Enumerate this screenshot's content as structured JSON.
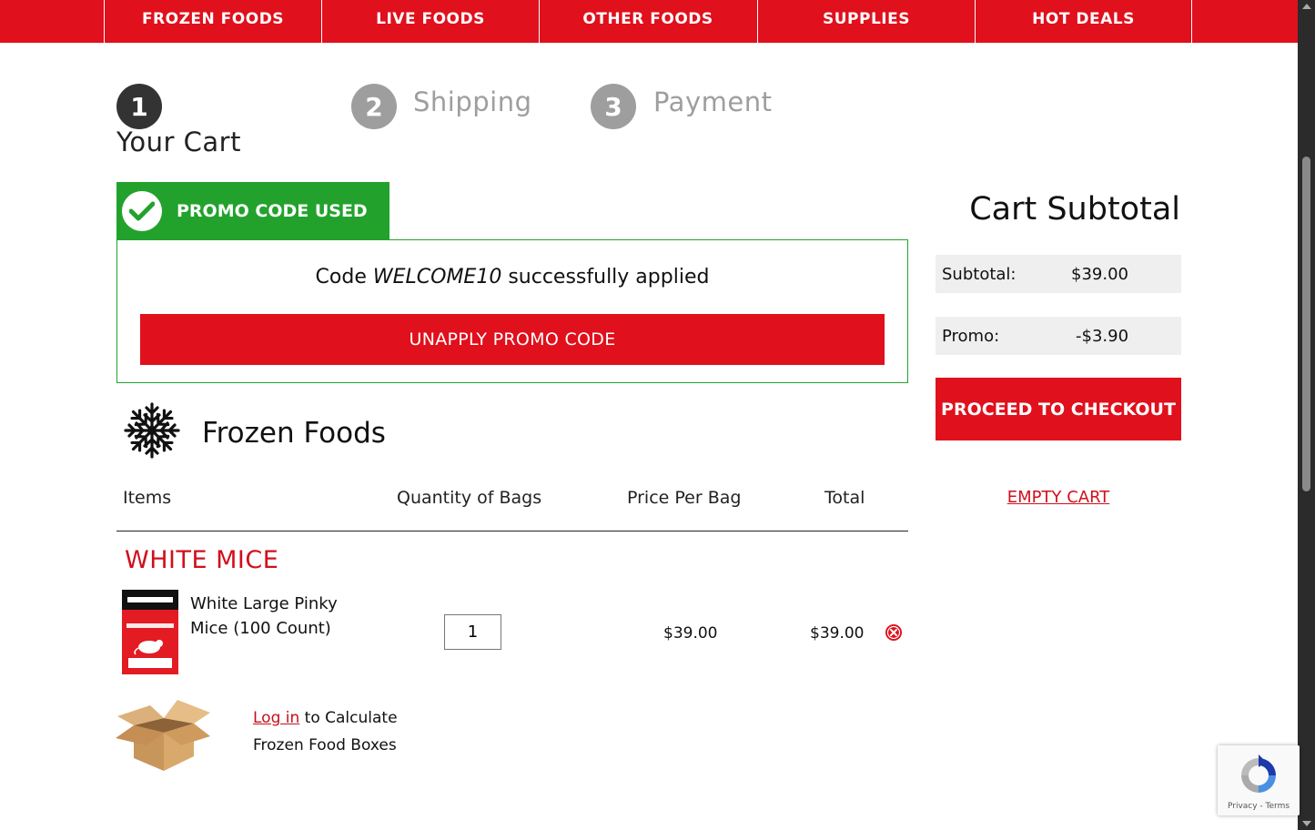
{
  "nav": {
    "tabs": [
      "FROZEN FOODS",
      "LIVE FOODS",
      "OTHER FOODS",
      "SUPPLIES",
      "HOT DEALS"
    ]
  },
  "steps": [
    {
      "number": "1",
      "label": "Your Cart",
      "active": true
    },
    {
      "number": "2",
      "label": "Shipping",
      "active": false
    },
    {
      "number": "3",
      "label": "Payment",
      "active": false
    }
  ],
  "promo": {
    "header": "PROMO CODE USED",
    "message_prefix": "Code",
    "code": "WELCOME10",
    "message_suffix": "successfully applied",
    "unapply_label": "UNAPPLY PROMO CODE"
  },
  "section": {
    "title": "Frozen Foods",
    "icon": "snowflake-icon",
    "columns": [
      "Items",
      "Quantity of Bags",
      "Price Per Bag",
      "Total"
    ],
    "group": "WHITE MICE",
    "items": [
      {
        "name": "White Large Pinky Mice (100 Count)",
        "quantity": "1",
        "price": "$39.00",
        "total": "$39.00"
      }
    ],
    "login_link": "Log in",
    "login_text_1": "to Calculate",
    "login_text_2": "Frozen Food Boxes"
  },
  "summary": {
    "title": "Cart Subtotal",
    "subtotal_label": "Subtotal:",
    "subtotal_value": "$39.00",
    "promo_label": "Promo:",
    "promo_value": "-$3.90",
    "checkout_label": "PROCEED TO CHECKOUT",
    "empty_cart_label": "EMPTY CART"
  },
  "recaptcha": {
    "links": "Privacy - Terms"
  },
  "colors": {
    "brand_red": "#e0101c",
    "promo_green": "#22a22c",
    "step_active": "#333333",
    "step_inactive": "#9e9e9e"
  }
}
